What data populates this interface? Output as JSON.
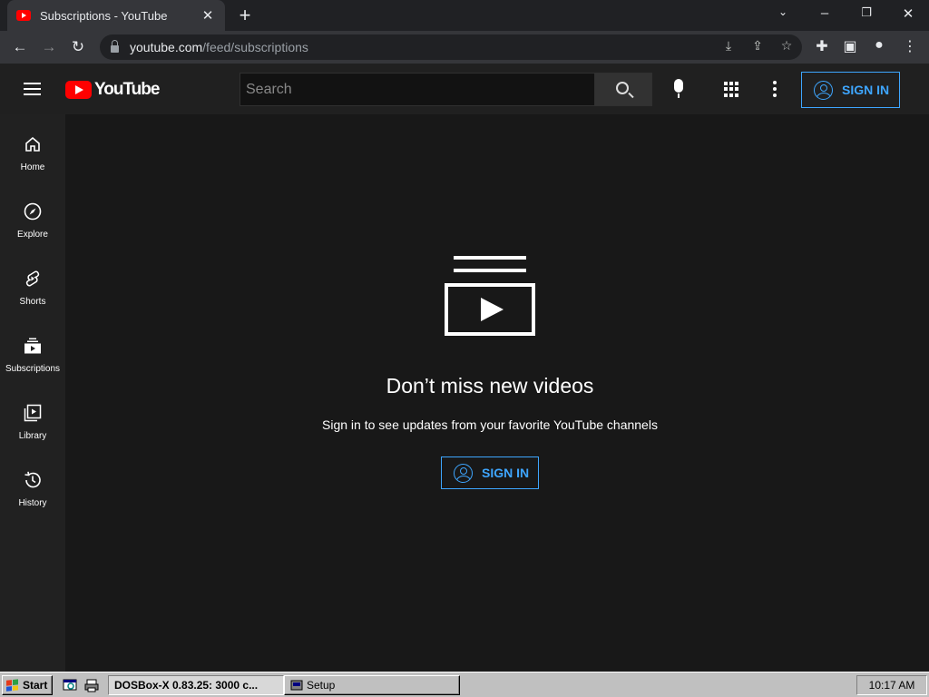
{
  "browser": {
    "tab_title": "Subscriptions - YouTube",
    "url_domain": "youtube.com",
    "url_path": "/feed/subscriptions",
    "icons": [
      "back-icon",
      "forward-icon",
      "reload-icon",
      "lock-icon",
      "install-icon",
      "share-icon",
      "bookmark-star-icon",
      "extensions-icon",
      "side-panel-icon",
      "profile-icon",
      "browser-menu-icon"
    ]
  },
  "youtube": {
    "logo_text": "YouTube",
    "search_placeholder": "Search",
    "header_signin": "SIGN IN",
    "sidebar": [
      {
        "label": "Home",
        "icon": "home-icon"
      },
      {
        "label": "Explore",
        "icon": "compass-icon"
      },
      {
        "label": "Shorts",
        "icon": "shorts-icon"
      },
      {
        "label": "Subscriptions",
        "icon": "subscriptions-icon"
      },
      {
        "label": "Library",
        "icon": "library-icon"
      },
      {
        "label": "History",
        "icon": "history-icon"
      }
    ],
    "main": {
      "headline": "Don’t miss new videos",
      "subline": "Sign in to see updates from your favorite YouTube channels",
      "signin": "SIGN IN"
    },
    "accent_color": "#3ea6ff",
    "brand_color": "#ff0000"
  },
  "taskbar": {
    "start": "Start",
    "tasks": [
      "DOSBox-X 0.83.25: 3000 c...",
      "Setup"
    ],
    "clock": "10:17 AM"
  }
}
